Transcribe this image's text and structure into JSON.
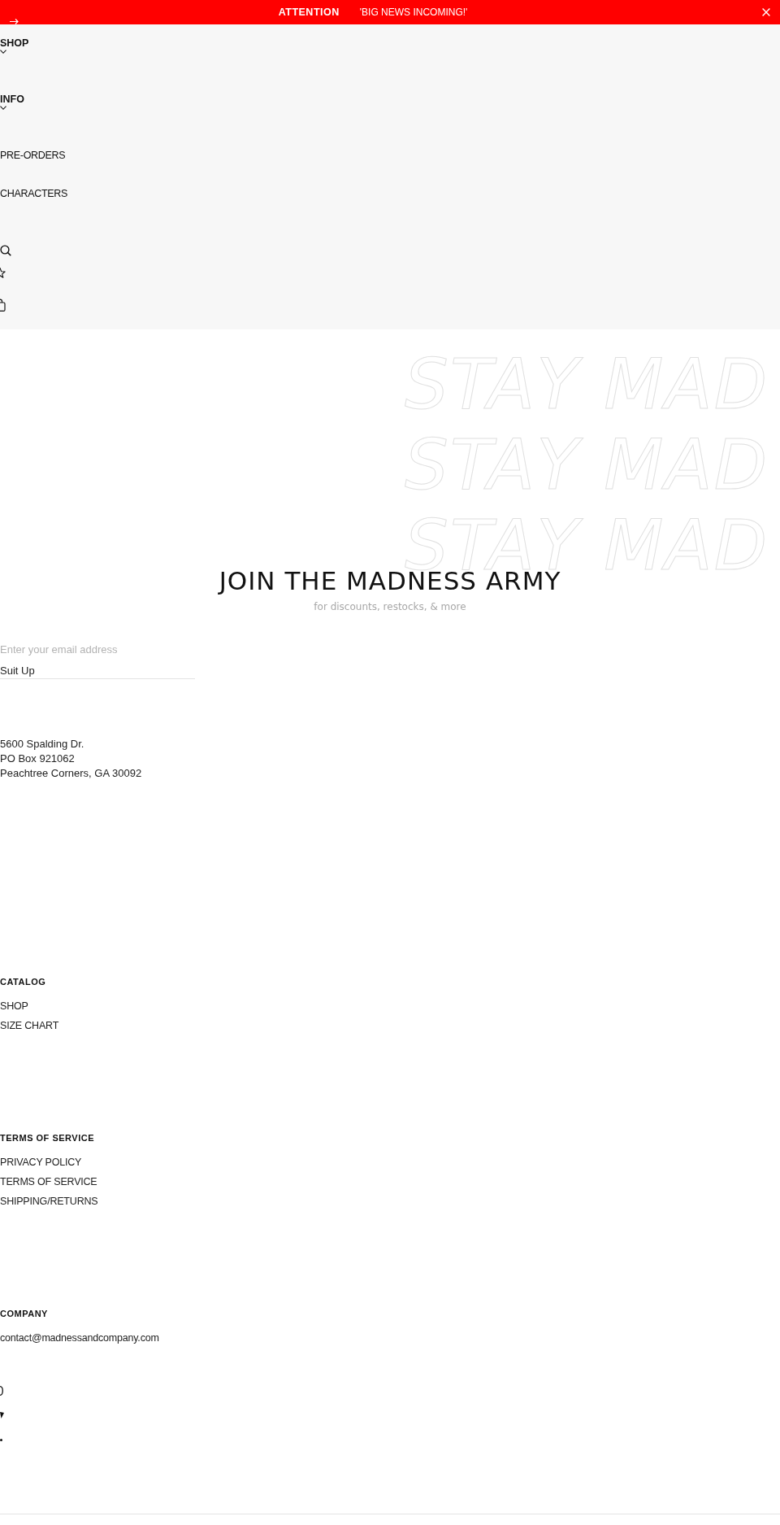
{
  "announcement": {
    "label": "ATTENTION",
    "message": "'BIG NEWS INCOMING!'"
  },
  "nav": {
    "items": [
      {
        "label": "SHOP",
        "kind": "dropdown"
      },
      {
        "label": "INFO",
        "kind": "dropdown"
      },
      {
        "label": "PRE-ORDERS",
        "kind": "link"
      },
      {
        "label": "CHARACTERS",
        "kind": "link"
      }
    ]
  },
  "newsletter": {
    "backdrop_lines": [
      "STAY MAD",
      "STAY MAD",
      "STAY MAD"
    ],
    "title": "JOIN THE MADNESS ARMY",
    "subtitle": "for discounts, restocks, & more",
    "email": {
      "placeholder": "Enter your email address"
    },
    "button": "Suit Up"
  },
  "address": [
    "5600 Spalding Dr.",
    "PO Box 921062",
    "Peachtree Corners, GA 30092"
  ],
  "footer": {
    "sections": [
      {
        "heading": "CATALOG",
        "links": [
          "SHOP",
          "SIZE CHART"
        ]
      },
      {
        "heading": "TERMS OF SERVICE",
        "links": [
          "PRIVACY POLICY",
          "TERMS OF SERVICE",
          "SHIPPING/RETURNS"
        ]
      },
      {
        "heading": "COMPANY",
        "links": [
          "contact@madnessandcompany.com"
        ]
      }
    ]
  }
}
